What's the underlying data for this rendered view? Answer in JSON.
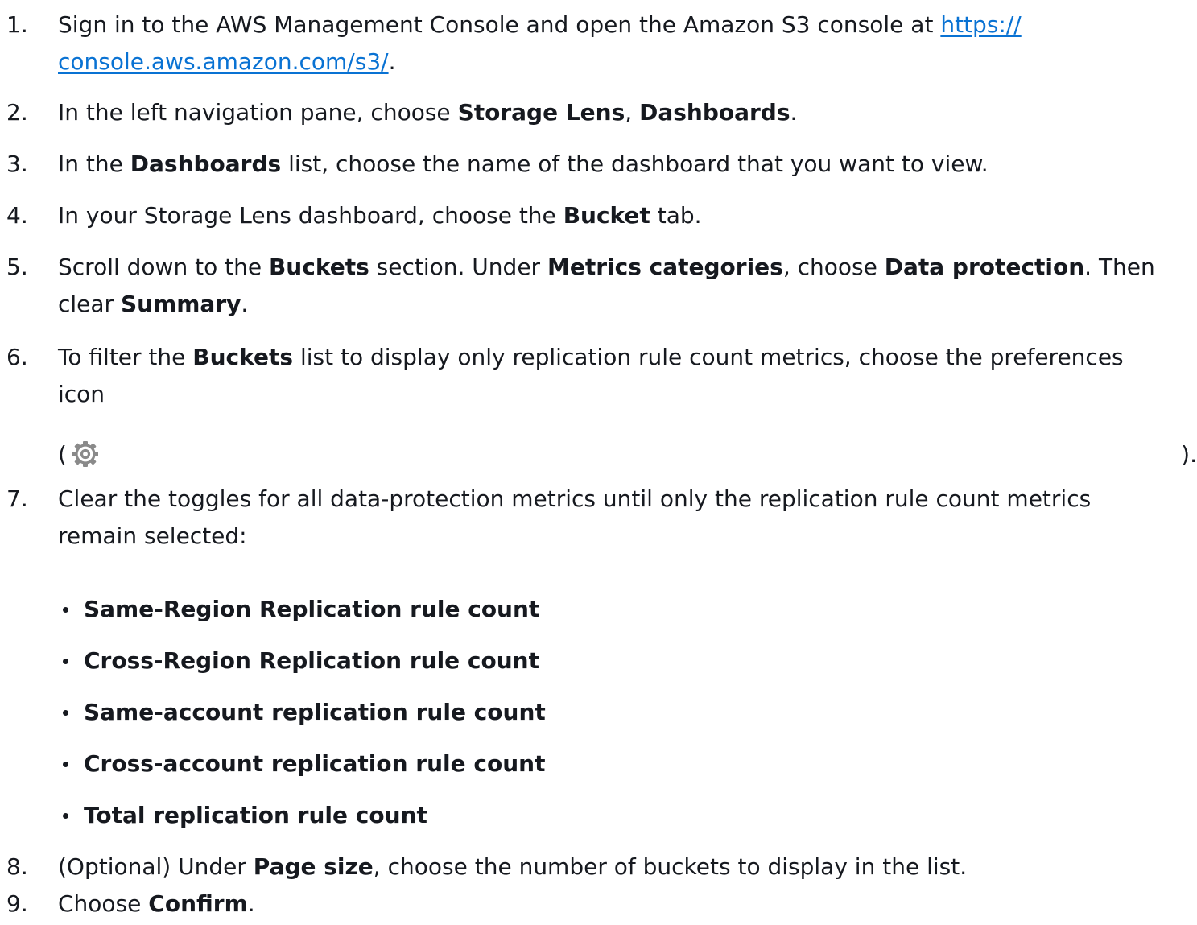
{
  "steps": [
    {
      "number": "1.",
      "text_before": "Sign in to the AWS Management Console and open the Amazon S3 console at ",
      "link_line1": "https://",
      "link_line2": "console.aws.amazon.com/s3/",
      "text_after": "."
    },
    {
      "number": "2.",
      "t1": "In the left navigation pane, choose ",
      "b1": "Storage Lens",
      "t2": ", ",
      "b2": "Dashboards",
      "t3": "."
    },
    {
      "number": "3.",
      "t1": "In the ",
      "b1": "Dashboards",
      "t2": " list, choose the name of the dashboard that you want to view."
    },
    {
      "number": "4.",
      "t1": "In your Storage Lens dashboard, choose the ",
      "b1": "Bucket",
      "t2": " tab."
    },
    {
      "number": "5.",
      "t1": "Scroll down to the ",
      "b1": "Buckets",
      "t2": " section. Under ",
      "b2": "Metrics categories",
      "t3": ", choose ",
      "b3": "Data protection",
      "t4": ". Then",
      "t5": "clear ",
      "b4": "Summary",
      "t6": "."
    },
    {
      "number": "6.",
      "t1": "To filter the ",
      "b1": "Buckets",
      "t2": " list to display only replication rule count metrics, choose the preferences",
      "t3": "icon",
      "paren_open": "(",
      "paren_close": ").",
      "icon": "gear-icon"
    },
    {
      "number": "7.",
      "t1": "Clear the toggles for all data-protection metrics until only the replication rule count metrics",
      "t2": "remain selected:",
      "bullets": [
        "Same-Region Replication rule count",
        "Cross-Region Replication rule count",
        "Same-account replication rule count",
        "Cross-account replication rule count",
        "Total replication rule count"
      ]
    },
    {
      "number": "8.",
      "t1": "(Optional) Under ",
      "b1": "Page size",
      "t2": ", choose the number of buckets to display in the list."
    },
    {
      "number": "9.",
      "t1": "Choose ",
      "b1": "Confirm",
      "t2": "."
    }
  ],
  "colors": {
    "text": "#16191f",
    "link": "#0972d3",
    "icon_gray": "#8a8a8a"
  }
}
